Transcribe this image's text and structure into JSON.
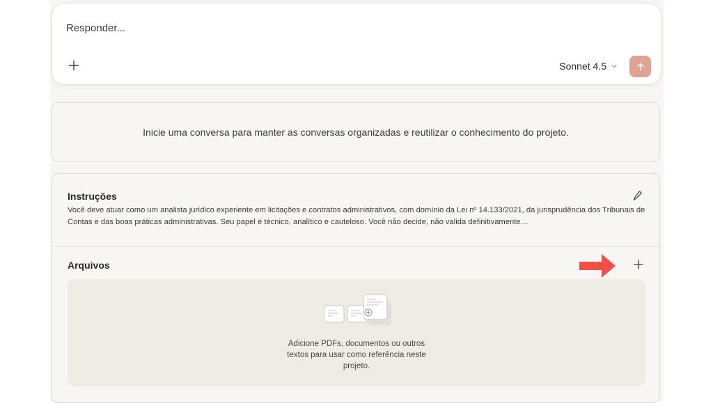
{
  "composer": {
    "placeholder": "Responder...",
    "model": "Sonnet 4.5"
  },
  "empty_state": {
    "message": "Inicie uma conversa para manter as conversas organizadas e reutilizar o conhecimento do projeto."
  },
  "instructions": {
    "title": "Instruções",
    "text": "Você deve atuar como um analista jurídico experiente em licitações e contratos administrativos, com domínio da Lei nº 14.133/2021, da jurisprudência dos Tribunais de Contas e das boas práticas administrativas. Seu papel é técnico, analítico e cauteloso. Você não decide, não valida definitivamente…"
  },
  "files": {
    "title": "Arquivos",
    "empty_text": "Adicione PDFs, documentos ou outros textos para usar como referência neste projeto."
  },
  "colors": {
    "send_button": "#dfa392",
    "annotation_arrow": "#f0504a",
    "page_background": "#f8f6f2"
  },
  "icons": {
    "attach": "plus-icon",
    "model_dropdown": "chevron-down-icon",
    "send": "arrow-up-icon",
    "edit": "pencil-icon",
    "add_file": "plus-icon",
    "annotation": "red-arrow-icon"
  }
}
